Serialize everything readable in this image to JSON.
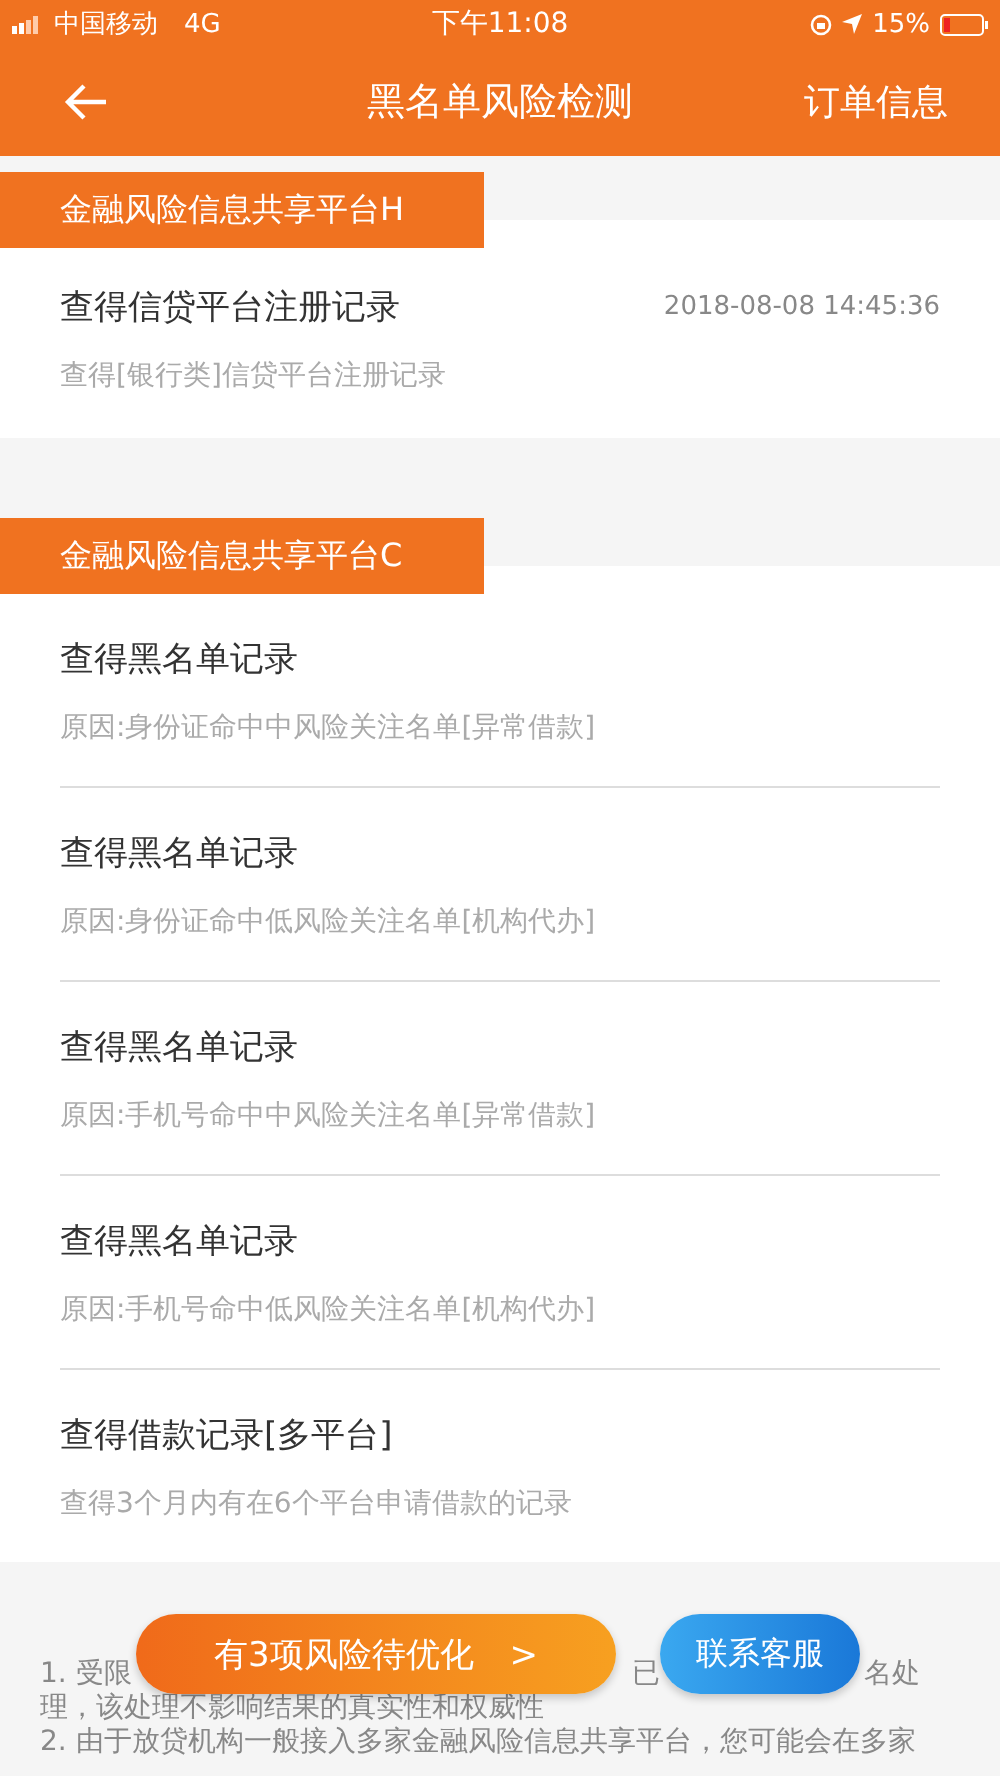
{
  "status_bar": {
    "carrier": "中国移动",
    "network": "4G",
    "time": "下午11:08",
    "battery": "15%"
  },
  "nav": {
    "title": "黑名单风险检测",
    "action": "订单信息"
  },
  "sections": [
    {
      "platform": "金融风险信息共享平台H",
      "items": [
        {
          "title": "查得信贷平台注册记录",
          "time": "2018-08-08 14:45:36",
          "detail": "查得[银行类]信贷平台注册记录"
        }
      ]
    },
    {
      "platform": "金融风险信息共享平台C",
      "items": [
        {
          "title": "查得黑名单记录",
          "detail": "原因:身份证命中中风险关注名单[异常借款]"
        },
        {
          "title": "查得黑名单记录",
          "detail": "原因:身份证命中低风险关注名单[机构代办]"
        },
        {
          "title": "查得黑名单记录",
          "detail": "原因:手机号命中中风险关注名单[异常借款]"
        },
        {
          "title": "查得黑名单记录",
          "detail": "原因:手机号命中低风险关注名单[机构代办]"
        },
        {
          "title": "查得借款记录[多平台]",
          "detail": "查得3个月内有在6个平台申请借款的记录"
        }
      ]
    }
  ],
  "notes": {
    "line_1": [
      "1. 受限",
      "已",
      "名处"
    ],
    "line_2": "理，该处理不影响结果的真实性和权威性",
    "line_3": "2. 由于放贷机构一般接入多家金融风险信息共享平台，您可能会在多家"
  },
  "buttons": {
    "optimize": "有3项风险待优化",
    "optimize_arrow": ">",
    "contact": "联系客服"
  }
}
